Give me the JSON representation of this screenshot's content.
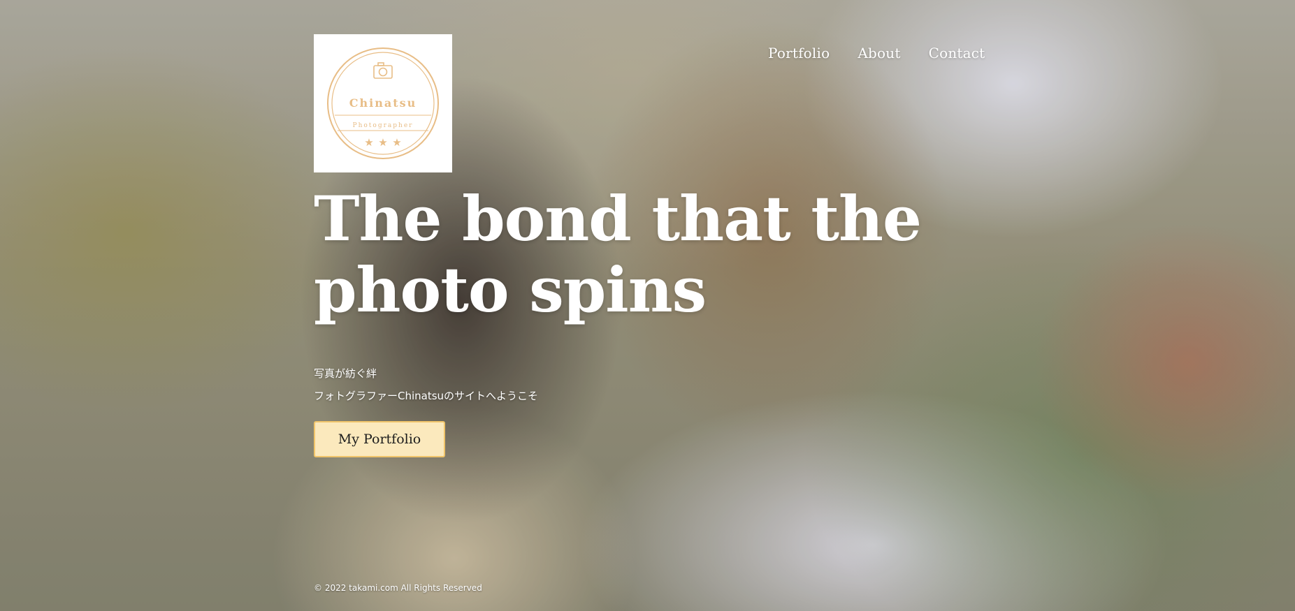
{
  "logo": {
    "name": "Chinatsu",
    "tagline": "Photographer",
    "icon": "camera-icon",
    "accent_color": "#e8bd86"
  },
  "nav": {
    "items": [
      {
        "label": "Portfolio"
      },
      {
        "label": "About"
      },
      {
        "label": "Contact"
      }
    ]
  },
  "hero": {
    "title_line1": "The bond that the",
    "title_line2": "photo spins",
    "subtitle_jp": "写真が紡ぐ絆",
    "welcome_jp": "フォトグラファーChinatsuのサイトへようこそ",
    "cta_label": "My Portfolio",
    "cta_bg_color": "#fbe9bd",
    "cta_border_color": "#f0c46a"
  },
  "footer": {
    "copyright": "© 2022 takami.com All Rights Reserved"
  }
}
